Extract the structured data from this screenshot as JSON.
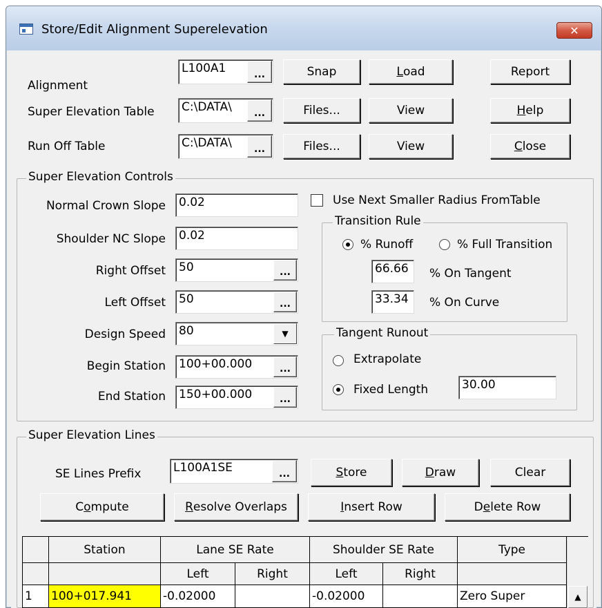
{
  "window": {
    "title": "Store/Edit Alignment Superelevation",
    "close_glyph": "✕"
  },
  "top": {
    "alignment_label": "Alignment",
    "alignment_value": "L100A1",
    "se_table_label": "Super Elevation Table",
    "se_table_value": "C:\\DATA\\",
    "runoff_label": "Run Off Table",
    "runoff_value": "C:\\DATA\\",
    "ellipsis": "...",
    "snap": "Snap",
    "load_u": "L",
    "load_rest": "oad",
    "files1": "Files...",
    "files2": "Files...",
    "view1": "View",
    "view2": "View",
    "report": "Report",
    "help_u": "H",
    "help_rest": "elp",
    "close_u": "C",
    "close_rest": "lose"
  },
  "controls": {
    "group_title": "Super Elevation Controls",
    "normal_crown_label": "Normal Crown Slope",
    "normal_crown_value": "0.02",
    "shoulder_nc_label": "Shoulder NC Slope",
    "shoulder_nc_value": "0.02",
    "right_offset_label": "Right Offset",
    "right_offset_value": "50",
    "left_offset_label": "Left Offset",
    "left_offset_value": "50",
    "design_speed_label": "Design Speed",
    "design_speed_value": "80",
    "begin_station_label": "Begin Station",
    "begin_station_value": "100+00.000",
    "end_station_label": "End Station",
    "end_station_value": "150+00.000",
    "use_next_smaller_label": "Use Next Smaller Radius FromTable",
    "use_next_smaller_checked": false
  },
  "transition": {
    "group_title": "Transition Rule",
    "runoff_label": "% Runoff",
    "full_label": "% Full Transition",
    "selected": "runoff",
    "on_tangent_value": "66.66",
    "on_tangent_label": "% On Tangent",
    "on_curve_value": "33.34",
    "on_curve_label": "% On Curve"
  },
  "tangent_runout": {
    "group_title": "Tangent Runout",
    "extrapolate_label": "Extrapolate",
    "fixed_length_label": "Fixed Length",
    "selected": "fixed",
    "fixed_length_value": "30.00"
  },
  "lines": {
    "group_title": "Super Elevation Lines",
    "prefix_label": "SE Lines Prefix",
    "prefix_value": "L100A1SE",
    "store_u": "S",
    "store_rest": "tore",
    "draw_u": "D",
    "draw_rest": "raw",
    "clear": "Clear",
    "compute_pre": "C",
    "compute_u": "o",
    "compute_rest": "mpute",
    "resolve_u": "R",
    "resolve_rest": "esolve Overlaps",
    "insert_u": "I",
    "insert_rest": "nsert Row",
    "delete_pre": "D",
    "delete_u": "e",
    "delete_rest": "lete Row"
  },
  "table": {
    "headers": {
      "station": "Station",
      "lane": "Lane SE Rate",
      "shoulder": "Shoulder SE Rate",
      "type": "Type",
      "left": "Left",
      "right": "Right"
    },
    "rows": [
      {
        "num": "1",
        "station": "100+017.941",
        "lane_left": "-0.02000",
        "lane_right": "",
        "shoulder_left": "-0.02000",
        "shoulder_right": "",
        "type": "Zero Super"
      }
    ],
    "highlight_color": "#ffff00",
    "scroll_up_glyph": "▲"
  }
}
